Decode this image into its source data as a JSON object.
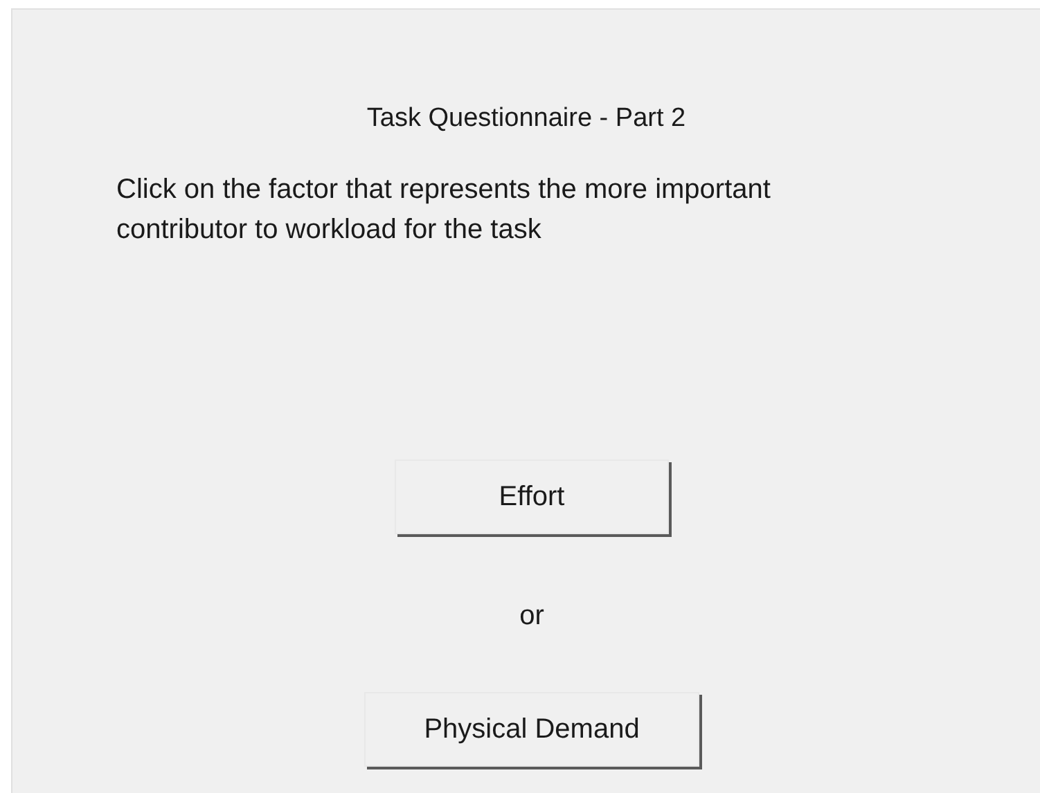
{
  "title": "Task Questionnaire - Part 2",
  "instruction": "Click on the factor that represents the more important contributor to workload for the task",
  "options": [
    {
      "label": "Effort"
    },
    {
      "label": "Physical Demand"
    }
  ],
  "separator": "or"
}
